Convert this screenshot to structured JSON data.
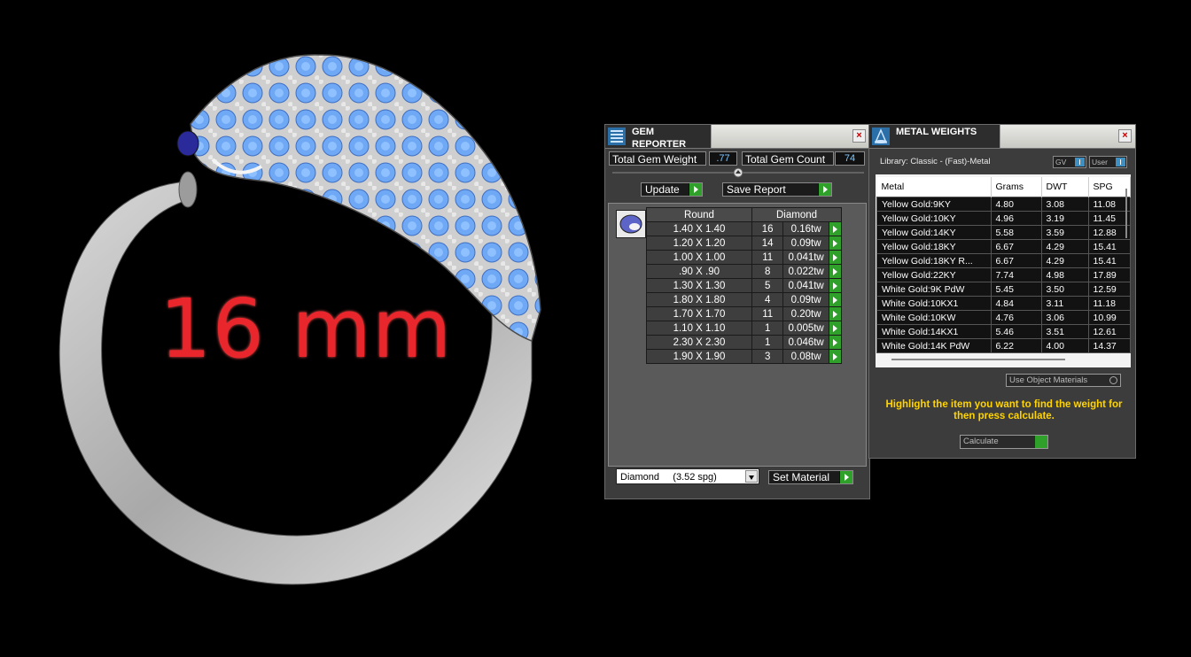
{
  "viewport": {
    "dimension_label": "16 mm"
  },
  "gem_reporter": {
    "title": "GEM REPORTER",
    "total_weight_label": "Total Gem Weight",
    "total_weight_value": ".77",
    "total_count_label": "Total Gem Count",
    "total_count_value": "74",
    "update_label": "Update",
    "save_report_label": "Save Report",
    "col_shape": "Round",
    "col_material": "Diamond",
    "rows": [
      {
        "size": "1.40 X 1.40",
        "count": "16",
        "weight": "0.16tw"
      },
      {
        "size": "1.20 X 1.20",
        "count": "14",
        "weight": "0.09tw"
      },
      {
        "size": "1.00 X 1.00",
        "count": "11",
        "weight": "0.041tw"
      },
      {
        "size": ".90 X .90",
        "count": "8",
        "weight": "0.022tw"
      },
      {
        "size": "1.30 X 1.30",
        "count": "5",
        "weight": "0.041tw"
      },
      {
        "size": "1.80 X 1.80",
        "count": "4",
        "weight": "0.09tw"
      },
      {
        "size": "1.70 X 1.70",
        "count": "11",
        "weight": "0.20tw"
      },
      {
        "size": "1.10 X 1.10",
        "count": "1",
        "weight": "0.005tw"
      },
      {
        "size": "2.30 X 2.30",
        "count": "1",
        "weight": "0.046tw"
      },
      {
        "size": "1.90 X 1.90",
        "count": "3",
        "weight": "0.08tw"
      }
    ],
    "material_select": "Diamond     (3.52 spg)",
    "set_material_label": "Set Material"
  },
  "metal_weights": {
    "title": "METAL WEIGHTS",
    "library": "Library: Classic - (Fast)-Metal",
    "toggle_gv": "GV",
    "toggle_user": "User",
    "columns": [
      "Metal",
      "Grams",
      "DWT",
      "SPG"
    ],
    "rows": [
      {
        "metal": "Yellow Gold:9KY",
        "grams": "4.80",
        "dwt": "3.08",
        "spg": "11.08"
      },
      {
        "metal": "Yellow Gold:10KY",
        "grams": "4.96",
        "dwt": "3.19",
        "spg": "11.45"
      },
      {
        "metal": "Yellow Gold:14KY",
        "grams": "5.58",
        "dwt": "3.59",
        "spg": "12.88"
      },
      {
        "metal": "Yellow Gold:18KY",
        "grams": "6.67",
        "dwt": "4.29",
        "spg": "15.41"
      },
      {
        "metal": "Yellow Gold:18KY R...",
        "grams": "6.67",
        "dwt": "4.29",
        "spg": "15.41"
      },
      {
        "metal": "Yellow Gold:22KY",
        "grams": "7.74",
        "dwt": "4.98",
        "spg": "17.89"
      },
      {
        "metal": "White Gold:9K PdW",
        "grams": "5.45",
        "dwt": "3.50",
        "spg": "12.59"
      },
      {
        "metal": "White Gold:10KX1",
        "grams": "4.84",
        "dwt": "3.11",
        "spg": "11.18"
      },
      {
        "metal": "White Gold:10KW",
        "grams": "4.76",
        "dwt": "3.06",
        "spg": "10.99"
      },
      {
        "metal": "White Gold:14KX1",
        "grams": "5.46",
        "dwt": "3.51",
        "spg": "12.61"
      },
      {
        "metal": "White Gold:14K PdW",
        "grams": "6.22",
        "dwt": "4.00",
        "spg": "14.37"
      }
    ],
    "use_object_materials": "Use Object Materials",
    "hint": "Highlight the item you want to find the weight for then press calculate.",
    "calculate_label": "Calculate"
  },
  "colors": {
    "accent_green": "#2fa02a",
    "hint_yellow": "#ffd400",
    "gem_blue": "#6fa8f5",
    "dimension_red": "#e8262c"
  }
}
